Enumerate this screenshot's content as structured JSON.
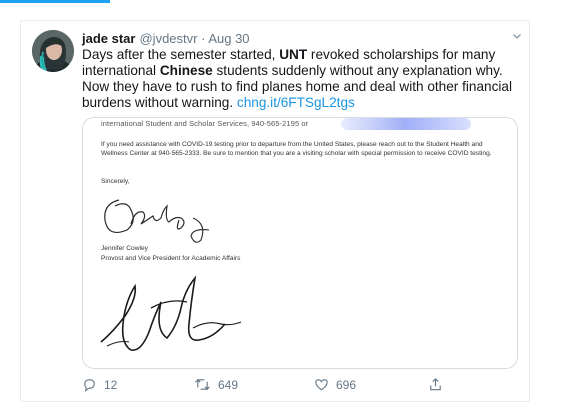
{
  "tweet": {
    "author_name": "jade star",
    "author_handle": "@jvdestvr",
    "date_sep": " · ",
    "date": "Aug 30",
    "text_part1": "Days after the semester started, ",
    "text_bold1": "UNT",
    "text_part2": " revoked scholarships for many international ",
    "text_bold2": "Chinese",
    "text_part3": " students suddenly without any explanation why. Now they have to rush to find planes home and deal with other financial burdens without warning. ",
    "link": "chng.it/6FTSgL2tgs"
  },
  "letter": {
    "cutoff_line": "international Student and Scholar Services, 940-565-2195 or",
    "body": "If you need assistance with COVID-19 testing prior to departure from the United States, please reach out to the Student Health and Wellness Center at 940-565-2333. Be sure to mention that you are a visiting scholar with special permission to receive COVID testing.",
    "closing": "Sincerely,",
    "signer_name": "Jennifer Cowley",
    "signer_title": "Provost and Vice President for Academic Affairs"
  },
  "actions": {
    "reply_count": "12",
    "retweet_count": "649",
    "like_count": "696"
  },
  "icons": {
    "reply": "reply-icon",
    "retweet": "retweet-icon",
    "like": "heart-icon",
    "share": "share-icon",
    "menu": "chevron-down-icon"
  },
  "colors": {
    "link": "#1b95e0",
    "muted": "#657786",
    "accent": "#1da1f2"
  }
}
